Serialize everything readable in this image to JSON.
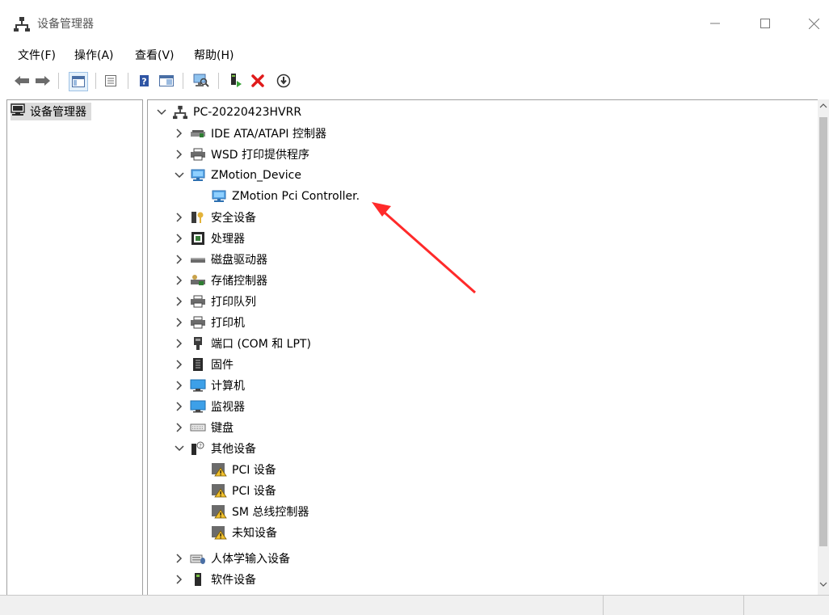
{
  "window": {
    "title": "设备管理器",
    "controls": {
      "minimize": "—",
      "maximize": "☐",
      "close": "✕"
    }
  },
  "menu": [
    "文件(F)",
    "操作(A)",
    "查看(V)",
    "帮助(H)"
  ],
  "toolbar": {
    "icons": [
      "back-arrow-icon",
      "forward-arrow-icon",
      "show-hide-console-tree-icon",
      "properties-icon",
      "help-icon",
      "view-icon",
      "scan-hardware-icon",
      "update-driver-icon",
      "uninstall-icon",
      "enable-device-icon"
    ]
  },
  "left_pane": {
    "root_label": "设备管理器"
  },
  "tree": {
    "root": "PC-20220423HVRR",
    "items": [
      {
        "label": "IDE ATA/ATAPI 控制器",
        "expanded": false,
        "icon": "ide-controller-icon",
        "level": 1
      },
      {
        "label": "WSD 打印提供程序",
        "expanded": false,
        "icon": "printer-icon",
        "level": 1
      },
      {
        "label": "ZMotion_Device",
        "expanded": true,
        "icon": "network-device-icon",
        "level": 1
      },
      {
        "label": "ZMotion Pci Controller.",
        "expanded": null,
        "icon": "network-device-icon",
        "level": 2
      },
      {
        "label": "安全设备",
        "expanded": false,
        "icon": "security-device-icon",
        "level": 1
      },
      {
        "label": "处理器",
        "expanded": false,
        "icon": "processor-icon",
        "level": 1
      },
      {
        "label": "磁盘驱动器",
        "expanded": false,
        "icon": "disk-drive-icon",
        "level": 1
      },
      {
        "label": "存储控制器",
        "expanded": false,
        "icon": "storage-controller-icon",
        "level": 1
      },
      {
        "label": "打印队列",
        "expanded": false,
        "icon": "printer-icon",
        "level": 1
      },
      {
        "label": "打印机",
        "expanded": false,
        "icon": "printer-icon",
        "level": 1
      },
      {
        "label": "端口 (COM 和 LPT)",
        "expanded": false,
        "icon": "port-icon",
        "level": 1
      },
      {
        "label": "固件",
        "expanded": false,
        "icon": "firmware-icon",
        "level": 1
      },
      {
        "label": "计算机",
        "expanded": false,
        "icon": "computer-icon",
        "level": 1
      },
      {
        "label": "监视器",
        "expanded": false,
        "icon": "monitor-icon",
        "level": 1
      },
      {
        "label": "键盘",
        "expanded": false,
        "icon": "keyboard-icon",
        "level": 1
      },
      {
        "label": "其他设备",
        "expanded": true,
        "icon": "other-devices-icon",
        "level": 1
      },
      {
        "label": "PCI 设备",
        "expanded": null,
        "icon": "unknown-device-warning-icon",
        "level": 2
      },
      {
        "label": "PCI 设备",
        "expanded": null,
        "icon": "unknown-device-warning-icon",
        "level": 2
      },
      {
        "label": "SM 总线控制器",
        "expanded": null,
        "icon": "unknown-device-warning-icon",
        "level": 2
      },
      {
        "label": "未知设备",
        "expanded": null,
        "icon": "unknown-device-warning-icon",
        "level": 2
      },
      {
        "label": "人体学输入设备",
        "expanded": false,
        "icon": "hid-icon",
        "level": 1
      },
      {
        "label": "软件设备",
        "expanded": false,
        "icon": "software-device-icon",
        "level": 1
      }
    ]
  },
  "colors": {
    "annotation_arrow": "#ff2a2a",
    "selection": "#dcdcdc"
  }
}
